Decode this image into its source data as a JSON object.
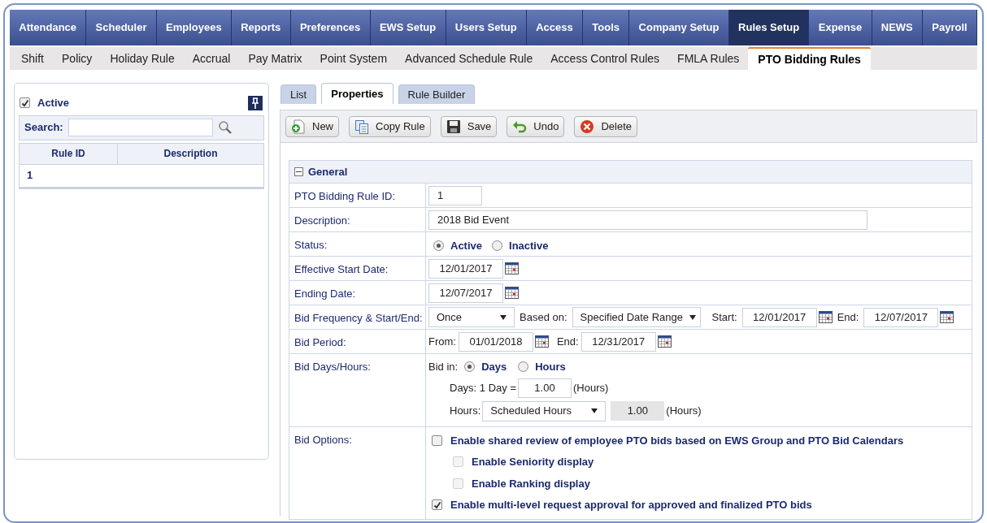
{
  "main_nav": [
    {
      "label": "Attendance",
      "selected": false
    },
    {
      "label": "Scheduler",
      "selected": false
    },
    {
      "label": "Employees",
      "selected": false
    },
    {
      "label": "Reports",
      "selected": false
    },
    {
      "label": "Preferences",
      "selected": false
    },
    {
      "label": "EWS Setup",
      "selected": false
    },
    {
      "label": "Users Setup",
      "selected": false
    },
    {
      "label": "Access",
      "selected": false
    },
    {
      "label": "Tools",
      "selected": false
    },
    {
      "label": "Company Setup",
      "selected": false
    },
    {
      "label": "Rules Setup",
      "selected": true
    },
    {
      "label": "Expense",
      "selected": false
    },
    {
      "label": "NEWS",
      "selected": false
    },
    {
      "label": "Payroll",
      "selected": false
    }
  ],
  "sub_nav": [
    {
      "label": "Shift",
      "selected": false
    },
    {
      "label": "Policy",
      "selected": false
    },
    {
      "label": "Holiday Rule",
      "selected": false
    },
    {
      "label": "Accrual",
      "selected": false
    },
    {
      "label": "Pay Matrix",
      "selected": false
    },
    {
      "label": "Point System",
      "selected": false
    },
    {
      "label": "Advanced Schedule Rule",
      "selected": false
    },
    {
      "label": "Access Control Rules",
      "selected": false
    },
    {
      "label": "FMLA Rules",
      "selected": false
    },
    {
      "label": "PTO Bidding Rules",
      "selected": true
    }
  ],
  "left_panel": {
    "active": {
      "label": "Active",
      "checked": true
    },
    "search_label": "Search:",
    "columns": [
      "Rule ID",
      "Description"
    ],
    "rows": [
      {
        "rule_id": "1"
      }
    ]
  },
  "tabs": [
    {
      "label": "List",
      "selected": false
    },
    {
      "label": "Properties",
      "selected": true
    },
    {
      "label": "Rule Builder",
      "selected": false
    }
  ],
  "toolbar": [
    {
      "label": "New",
      "kind": "new"
    },
    {
      "label": "Copy Rule",
      "kind": "copy"
    },
    {
      "label": "Save",
      "kind": "save"
    },
    {
      "label": "Undo",
      "kind": "undo"
    },
    {
      "label": "Delete",
      "kind": "delete"
    }
  ],
  "section": {
    "title": "General",
    "expanded": true
  },
  "fields": [
    {
      "kind": "short_text",
      "label": "PTO Bidding Rule ID:",
      "value": "1"
    },
    {
      "kind": "text",
      "label": "Description:",
      "value": "2018 Bid Event"
    },
    {
      "kind": "radio",
      "label": "Status:",
      "options": [
        {
          "label": "Active",
          "selected": true
        },
        {
          "label": "Inactive",
          "selected": false
        }
      ]
    },
    {
      "kind": "date",
      "label": "Effective Start Date:",
      "value": "12/01/2017"
    },
    {
      "kind": "date",
      "label": "Ending Date:",
      "value": "12/07/2017"
    },
    {
      "kind": "frequency",
      "label": "Bid Frequency & Start/End:",
      "frequency": "Once",
      "based_on_label": "Based on:",
      "based_on": "Specified Date Range",
      "start_label": "Start:",
      "start": "12/01/2017",
      "end_label": "End:",
      "end": "12/07/2017"
    },
    {
      "kind": "period",
      "label": "Bid Period:",
      "from_label": "From:",
      "from": "01/01/2018",
      "end_label": "End:",
      "end": "12/31/2017"
    },
    {
      "kind": "days_hours",
      "label": "Bid Days/Hours:",
      "bid_in_label": "Bid in:",
      "options": [
        {
          "label": "Days",
          "selected": true
        },
        {
          "label": "Hours",
          "selected": false
        }
      ],
      "days_label": "Days: 1 Day =",
      "days_value": "1.00",
      "days_unit": "(Hours)",
      "hours_label": "Hours:",
      "hours_select": "Scheduled Hours",
      "hours_value": "1.00",
      "hours_value_disabled": true,
      "hours_unit": "(Hours)"
    },
    {
      "kind": "options",
      "label": "Bid Options:",
      "options": [
        {
          "label": "Enable shared review of employee PTO bids based on EWS Group and PTO Bid Calendars",
          "checked": false,
          "disabled": false,
          "children": [
            {
              "label": "Enable Seniority display",
              "checked": false,
              "disabled": true
            },
            {
              "label": "Enable Ranking display",
              "checked": false,
              "disabled": true
            }
          ]
        },
        {
          "label": "Enable multi-level request approval for approved and finalized PTO bids",
          "checked": true,
          "disabled": false
        }
      ]
    }
  ]
}
